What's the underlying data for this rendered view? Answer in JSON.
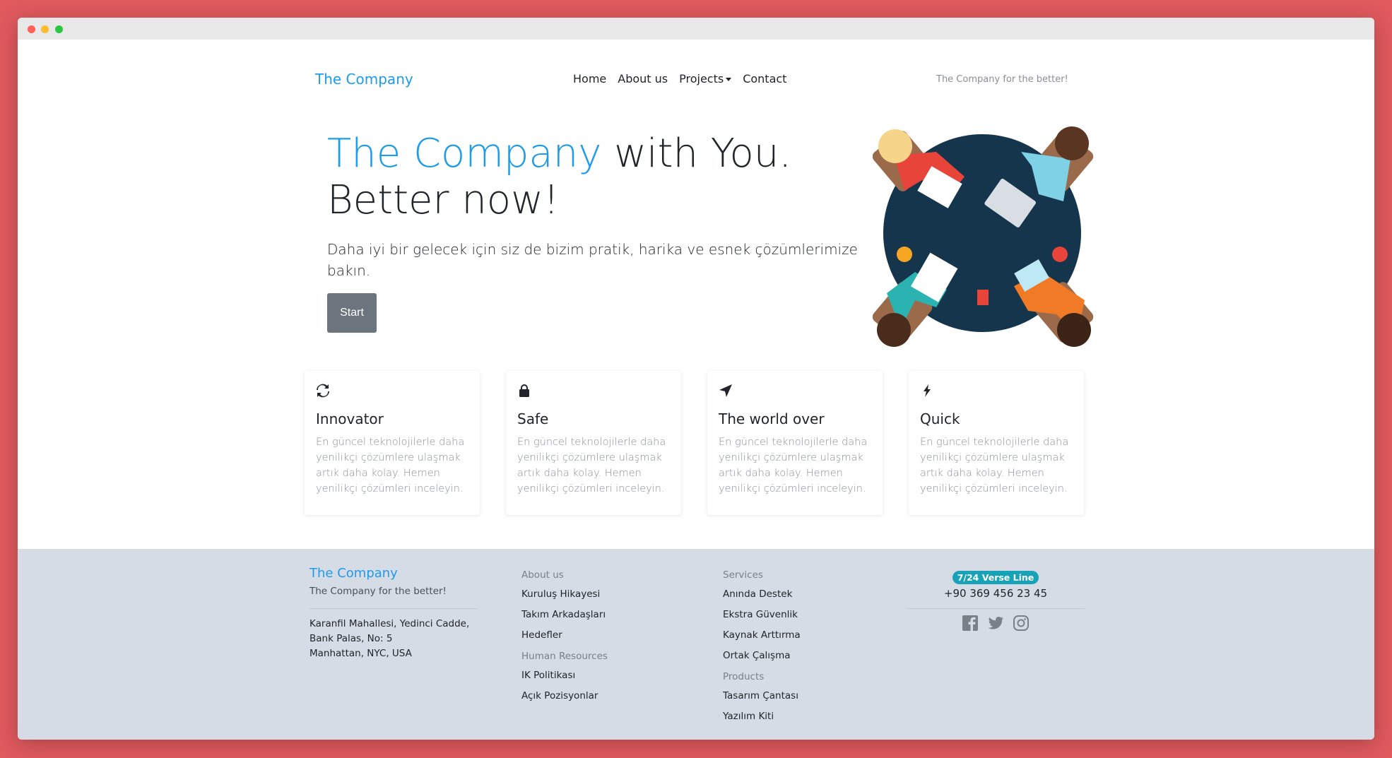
{
  "nav": {
    "brand": "The Company",
    "links": [
      "Home",
      "About us",
      "Projects",
      "Contact"
    ],
    "tagline": "The Company for the better!"
  },
  "hero": {
    "title_accent": "The Company",
    "title_rest": " with You.",
    "title_line2": "Better now!",
    "subtitle": "Daha iyi bir gelecek için siz de bizim pratik, harika ve esnek çözümlerimize bakın.",
    "start_label": "Start"
  },
  "features": [
    {
      "icon": "sync-icon",
      "title": "Innovator",
      "text": "En güncel teknolojilerle daha yenilikçi çözümlere ulaşmak artık daha kolay. Hemen yenilikçi çözümleri inceleyin."
    },
    {
      "icon": "lock-icon",
      "title": "Safe",
      "text": "En güncel teknolojilerle daha yenilikçi çözümlere ulaşmak artık daha kolay. Hemen yenilikçi çözümleri inceleyin."
    },
    {
      "icon": "location-arrow-icon",
      "title": "The world over",
      "text": "En güncel teknolojilerle daha yenilikçi çözümlere ulaşmak artık daha kolay. Hemen yenilikçi çözümleri inceleyin."
    },
    {
      "icon": "bolt-icon",
      "title": "Quick",
      "text": "En güncel teknolojilerle daha yenilikçi çözümlere ulaşmak artık daha kolay. Hemen yenilikçi çözümleri inceleyin."
    }
  ],
  "footer": {
    "brand": "The Company",
    "tagline": "The Company for the better!",
    "address": [
      "Karanfil Mahallesi, Yedinci Cadde,",
      "Bank Palas, No: 5",
      "Manhattan, NYC, USA"
    ],
    "about_head": "About us",
    "about_items": [
      "Kuruluş Hikayesi",
      "Takım Arkadaşları",
      "Hedefler"
    ],
    "hr_head": "Human Resources",
    "hr_items": [
      "IK Politikası",
      "Açık Pozisyonlar"
    ],
    "services_head": "Services",
    "services_items": [
      "Anında Destek",
      "Ekstra Güvenlik",
      "Kaynak Arttırma",
      "Ortak Çalışma"
    ],
    "products_head": "Products",
    "products_items": [
      "Tasarım Çantası",
      "Yazılım Kiti"
    ],
    "badge": "7/24 Verse Line",
    "phone": "+90 369 456 23 45",
    "socials": [
      "facebook-icon",
      "twitter-icon",
      "instagram-icon"
    ]
  },
  "colors": {
    "accent": "#1e9be9",
    "background": "#e05a5e",
    "footer_bg": "#d6dce6",
    "button": "#6c757d",
    "badge": "#17a2b8"
  }
}
